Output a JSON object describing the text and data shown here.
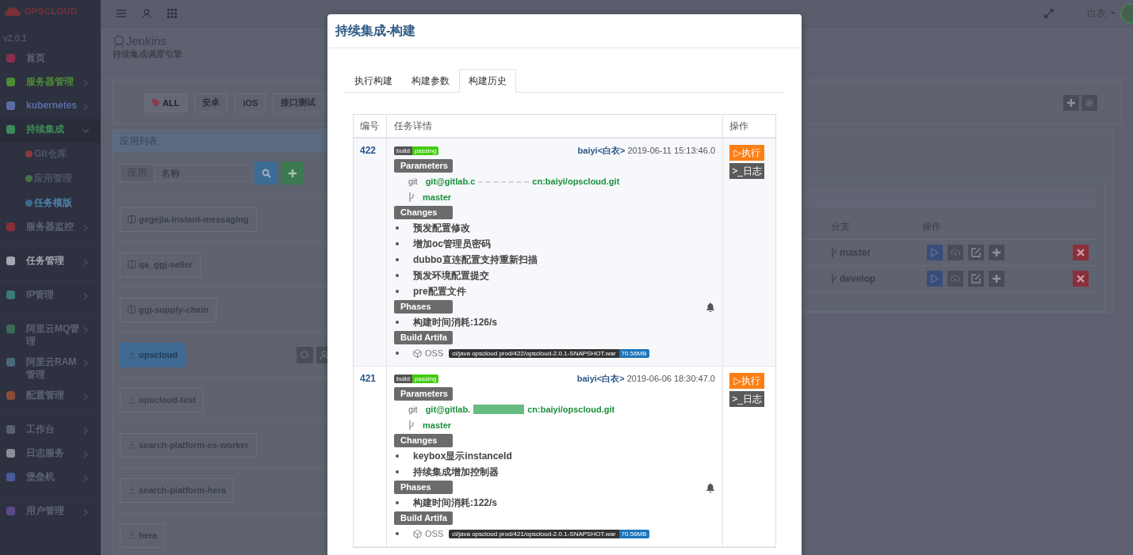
{
  "sidebar": {
    "brand": "OPSCLOUD",
    "version": "v2.0.1",
    "groups": [
      {
        "items": [
          {
            "label": "首页",
            "kind": "link",
            "color": "#8a2f4f",
            "highlighted": false
          },
          {
            "label": "服务器管理",
            "kind": "menu",
            "color": "#4f8a35",
            "highlighted": true,
            "expanded": false
          },
          {
            "label": "kubernetes",
            "kind": "menu",
            "color": "#5a6ca8",
            "highlighted": true,
            "expanded": false
          },
          {
            "label": "持续集成",
            "kind": "menu",
            "color": "#3f8a5a",
            "highlighted": true,
            "expanded": true,
            "children": [
              {
                "label": "Git仓库",
                "color": "#8a3a3a",
                "selected": false
              },
              {
                "label": "应用管理",
                "color": "#4a7040",
                "selected": false
              },
              {
                "label": "任务模版",
                "color": "#3a6a8a",
                "selected": true
              }
            ]
          },
          {
            "label": "服务器监控",
            "kind": "menu",
            "color": "#8a2f3a",
            "highlighted": false,
            "expanded": false
          }
        ]
      },
      {
        "items": [
          {
            "label": "任务管理",
            "kind": "menu",
            "color": "#a3a7b0",
            "highlighted": true,
            "expanded": false
          }
        ]
      },
      {
        "items": [
          {
            "label": "IP管理",
            "kind": "menu",
            "color": "#3c7a7a",
            "highlighted": false,
            "expanded": false
          }
        ]
      },
      {
        "items": [
          {
            "label": "阿里云MQ管理",
            "kind": "menu",
            "color": "#3a6a5a",
            "highlighted": false,
            "expanded": false
          },
          {
            "label": "阿里云RAM管理",
            "kind": "menu",
            "color": "#4a6a7a",
            "highlighted": false,
            "expanded": false
          },
          {
            "label": "配置管理",
            "kind": "menu",
            "color": "#8a4a3a",
            "highlighted": false,
            "expanded": false
          }
        ]
      },
      {
        "items": [
          {
            "label": "工作台",
            "kind": "menu",
            "color": "#5a6070",
            "highlighted": false,
            "expanded": false
          },
          {
            "label": "日志服务",
            "kind": "menu",
            "color": "#8a8e98",
            "highlighted": false,
            "expanded": false
          },
          {
            "label": "堡垒机",
            "kind": "menu",
            "color": "#4a5a9a",
            "highlighted": false,
            "expanded": false
          }
        ]
      },
      {
        "items": [
          {
            "label": "用户管理",
            "kind": "menu",
            "color": "#5a4a8a",
            "highlighted": false,
            "expanded": false
          }
        ]
      }
    ]
  },
  "topbar": {
    "user": "白衣"
  },
  "page": {
    "title": "Jenkins",
    "subtitle": "持续集成调度引擎"
  },
  "filters": [
    {
      "label": "ALL",
      "selected": true
    },
    {
      "label": "安卓",
      "selected": false
    },
    {
      "label": "iOS",
      "selected": false
    },
    {
      "label": "接口测试",
      "selected": false
    }
  ],
  "app_list": {
    "title": "应用列表",
    "addon": "应用",
    "placeholder": "名称",
    "apps": [
      {
        "name": "gegejia-instant-messaging",
        "kind": "toggle",
        "selected": false
      },
      {
        "name": "qa_ggj-seller",
        "kind": "toggle",
        "selected": false
      },
      {
        "name": "ggj-supply-chain",
        "kind": "toggle",
        "selected": false
      },
      {
        "name": "opscloud",
        "kind": "download",
        "selected": true
      },
      {
        "name": "opscloud-test",
        "kind": "download",
        "selected": false
      },
      {
        "name": "search-platform-es-worker",
        "kind": "download",
        "selected": false
      },
      {
        "name": "search-platform-hera",
        "kind": "download",
        "selected": false
      },
      {
        "name": "hera",
        "kind": "download",
        "selected": false
      }
    ]
  },
  "branches": {
    "columns": [
      "分支",
      "操作"
    ],
    "rows": [
      {
        "branch": "master"
      },
      {
        "branch": "develop"
      }
    ]
  },
  "modal": {
    "title": "持续集成-构建",
    "tabs": [
      {
        "label": "执行构建",
        "selected": false
      },
      {
        "label": "构建参数",
        "selected": false
      },
      {
        "label": "构建历史",
        "selected": true
      }
    ],
    "columns": [
      "编号",
      "任务详情",
      "操作"
    ],
    "builds": [
      {
        "number": "422",
        "badge_left": "build",
        "badge_right": "passing",
        "author": "baiyi<白衣>",
        "time": "2019-06-11 15:13:46.0",
        "params_label": "Parameters",
        "git_label": "git",
        "url_head": "git@gitlab.c",
        "kind": "faint",
        "url_tail": "cn:baiyi/opscloud.git",
        "branch": "master",
        "changes_label": "Changes",
        "changes": [
          "预发配置修改",
          "增加oc管理员密码",
          "dubbo直连配置支持重新扫描",
          "预发环境配置提交",
          "pre配置文件"
        ],
        "phases_label": "Phases",
        "phases": [
          "构建时间消耗:126/s"
        ],
        "artifacts_label": "Build Artifa",
        "storage": "OSS",
        "path": "ci/java opscloud prod/422/opscloud-2.0.1-SNAPSHOT.war",
        "size": "70.56MB",
        "run": "▷执行",
        "log": ">_日志"
      },
      {
        "number": "421",
        "badge_left": "build",
        "badge_right": "passing",
        "author": "baiyi<白衣>",
        "time": "2019-06-06 18:30:47.0",
        "params_label": "Parameters",
        "git_label": "git",
        "url_head": "git@gitlab.",
        "kind": "blot",
        "url_tail": "cn:baiyi/opscloud.git",
        "branch": "master",
        "changes_label": "Changes",
        "changes": [
          "keybox显示instanceId",
          "持续集成增加控制器"
        ],
        "phases_label": "Phases",
        "phases": [
          "构建时间消耗:122/s"
        ],
        "artifacts_label": "Build Artifa",
        "storage": "OSS",
        "path": "ci/java opscloud prod/421/opscloud-2.0.1-SNAPSHOT.war",
        "size": "70.56MB",
        "run": "▷执行",
        "log": ">_日志"
      }
    ]
  }
}
